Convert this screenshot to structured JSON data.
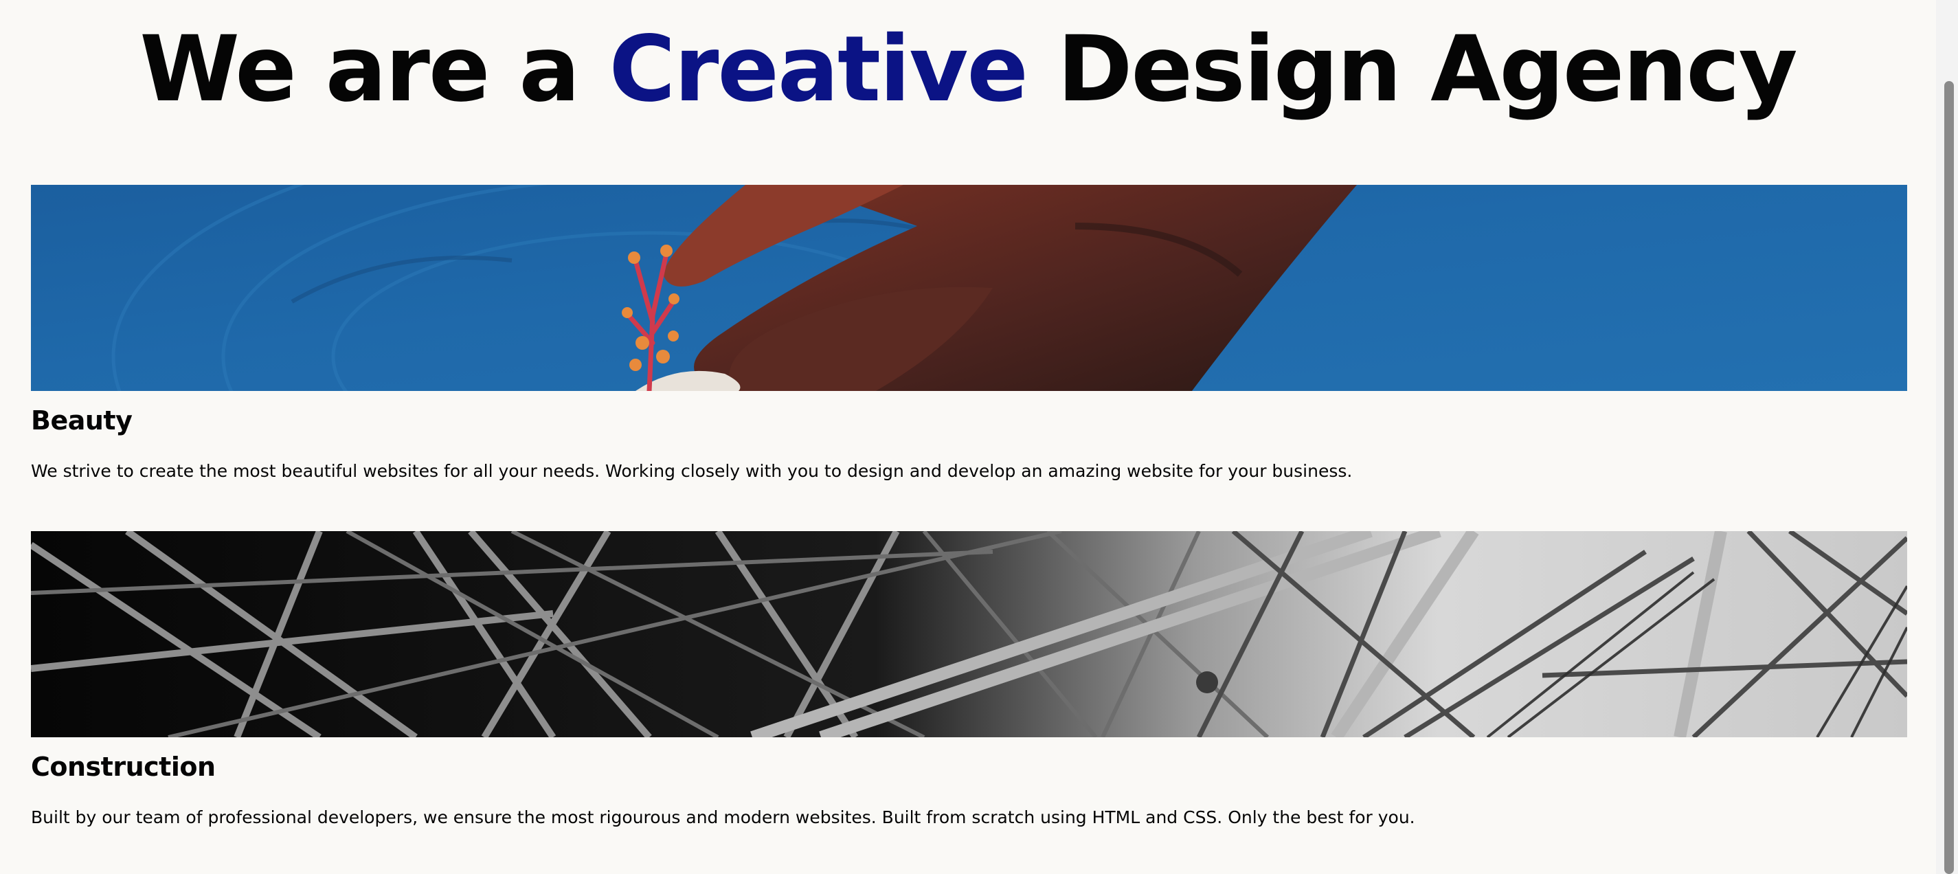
{
  "hero": {
    "title_before": "We are a ",
    "title_accent": "Creative",
    "title_after": " Design Agency",
    "accent_color": "#0b1385"
  },
  "cards": [
    {
      "title": "Beauty",
      "text": "We strive to create the most beautiful websites for all your needs. Working closely with you to design and develop an amazing website for your business.",
      "image": "hand-with-flower-in-blue-water"
    },
    {
      "title": "Construction",
      "text": "Built by our team of professional developers, we ensure the most rigourous and modern websites. Built from scratch using HTML and CSS. Only the best for you.",
      "image": "black-and-white-steel-truss-structure"
    }
  ],
  "colors": {
    "background": "#faf9f6",
    "water": "#1f66a6",
    "text": "#050505"
  }
}
